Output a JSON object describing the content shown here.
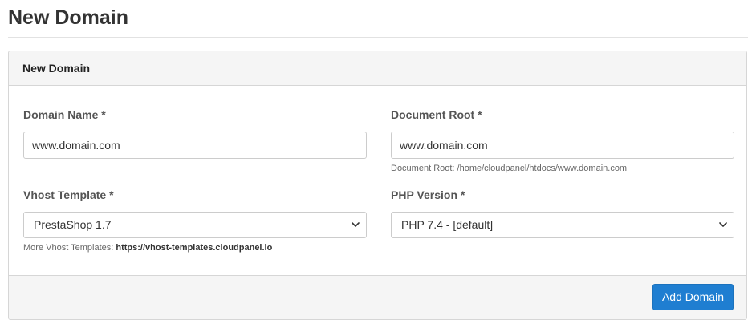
{
  "page": {
    "title": "New Domain"
  },
  "panel": {
    "heading": "New Domain",
    "fields": {
      "domain_name": {
        "label": "Domain Name *",
        "value": "www.domain.com"
      },
      "document_root": {
        "label": "Document Root *",
        "value": "www.domain.com",
        "help": "Document Root: /home/cloudpanel/htdocs/www.domain.com"
      },
      "vhost_template": {
        "label": "Vhost Template *",
        "selected": "PrestaShop 1.7",
        "help_prefix": "More Vhost Templates: ",
        "help_link": "https://vhost-templates.cloudpanel.io"
      },
      "php_version": {
        "label": "PHP Version *",
        "selected": "PHP 7.4 - [default]"
      }
    },
    "footer": {
      "submit_label": "Add Domain"
    }
  },
  "colors": {
    "primary_button": "#1f7ed1",
    "panel_bg": "#f5f5f5",
    "border": "#d6d6d6"
  },
  "icons": {
    "select_arrow": "chevron-down-icon"
  }
}
